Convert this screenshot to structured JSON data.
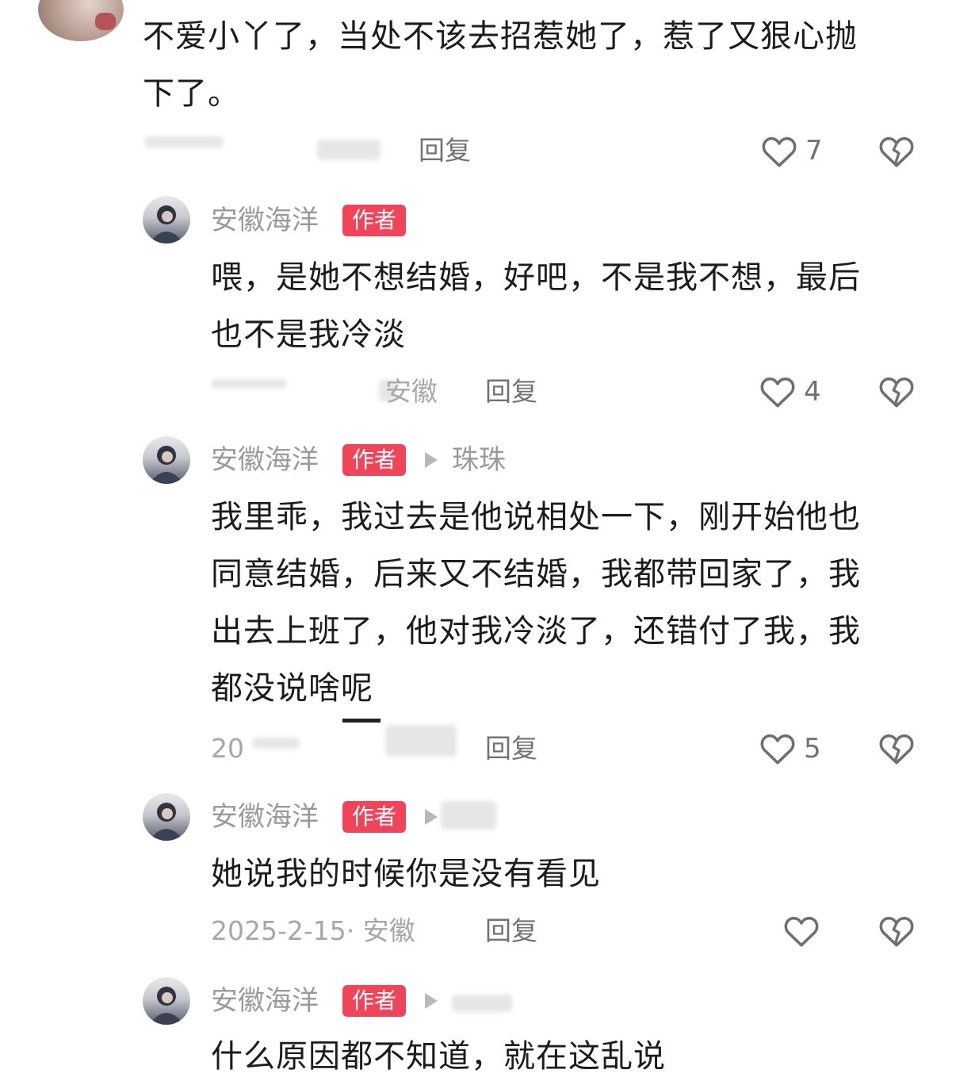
{
  "comments": [
    {
      "text_lines": [
        "不爱小丫了，当处不该去招惹她了，惹了又狠心抛",
        "下了。"
      ],
      "meta": "",
      "reply_label": "回复",
      "likes": "7"
    },
    {
      "author": "安徽海洋",
      "badge": "作者",
      "text_lines": [
        "喂，是她不想结婚，好吧，不是我不想，最后",
        "也不是我冷淡"
      ],
      "meta": "安徽",
      "reply_label": "回复",
      "likes": "4"
    },
    {
      "author": "安徽海洋",
      "badge": "作者",
      "reply_to": "珠珠",
      "text_lines": [
        "我里乖，我过去是他说相处一下，刚开始他也",
        "同意结婚，后来又不结婚，我都带回家了，我",
        "出去上班了，他对我冷淡了，还错付了我，我",
        "都没说啥呢"
      ],
      "meta": "20",
      "reply_label": "回复",
      "likes": "5"
    },
    {
      "author": "安徽海洋",
      "badge": "作者",
      "text_lines": [
        "她说我的时候你是没有看见"
      ],
      "meta": "2025-2-15· 安徽",
      "reply_label": "回复",
      "likes": ""
    },
    {
      "author": "安徽海洋",
      "badge": "作者",
      "text_lines": [
        "什么原因都不知道，就在这乱说"
      ]
    }
  ],
  "icons": {
    "like": "heart-outline-icon",
    "dislike": "broken-heart-icon"
  },
  "colors": {
    "badge_bg": "#f0445a",
    "name": "#9a9a9a",
    "text": "#1c1c1c"
  }
}
